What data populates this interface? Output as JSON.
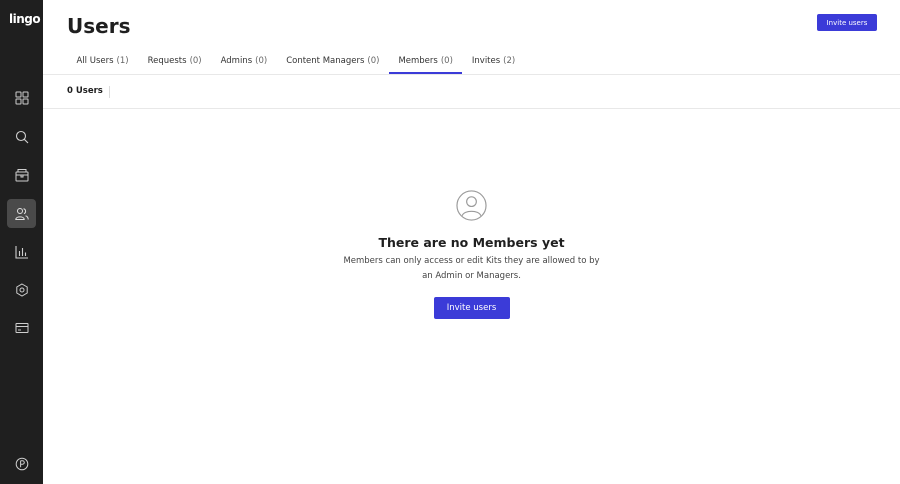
{
  "app": {
    "logo": "lingo"
  },
  "header": {
    "title": "Users",
    "invite_button": "Invite users"
  },
  "tabs": [
    {
      "label": "All Users",
      "count": "(1)"
    },
    {
      "label": "Requests",
      "count": "(0)"
    },
    {
      "label": "Admins",
      "count": "(0)"
    },
    {
      "label": "Content Managers",
      "count": "(0)"
    },
    {
      "label": "Members",
      "count": "(0)"
    },
    {
      "label": "Invites",
      "count": "(2)"
    }
  ],
  "active_tab": "Members",
  "summary": {
    "users_count": "0 Users"
  },
  "empty_state": {
    "icon": "user-circle-icon",
    "title": "There are no Members yet",
    "description": "Members can only access or edit Kits they are allowed to by an Admin or Managers.",
    "button": "Invite users"
  },
  "sidebar": {
    "icons": [
      "dashboard-icon",
      "search-icon",
      "box-icon",
      "users-icon",
      "analytics-icon",
      "settings-icon",
      "billing-icon",
      "help-icon"
    ],
    "active": "users-icon"
  },
  "colors": {
    "sidebar_bg": "#1f1f1f",
    "accent": "#3b3bd8",
    "active_nav": "#4a4a4a"
  }
}
